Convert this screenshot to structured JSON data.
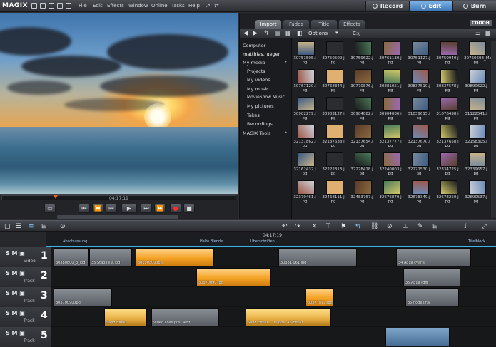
{
  "app": {
    "title": "MAGIX"
  },
  "menu": [
    "File",
    "Edit",
    "Effects",
    "Window",
    "Online",
    "Tasks",
    "Help"
  ],
  "modes": [
    {
      "label": "Record",
      "active": false
    },
    {
      "label": "Edit",
      "active": true
    },
    {
      "label": "Burn",
      "active": false
    }
  ],
  "preview": {
    "timecode": "04:17:19"
  },
  "browser": {
    "tabs": [
      "Import",
      "Fades",
      "Title",
      "Effects"
    ],
    "active_tab": "Import",
    "brand": "COOOH",
    "options_label": "Options",
    "path": "C:\\",
    "tree": [
      "Computer",
      "matthias.rueger",
      "My media",
      "Projects",
      "My videos",
      "My music",
      "MovieShow Music",
      "My pictures",
      "Takes",
      "Recordings",
      "MAGIX Tools"
    ],
    "files": [
      "30751505.jpg",
      "30750509.jpg",
      "30759622.jpg",
      "30761130.jpg",
      "30751127.jpg",
      "30750940.jpg",
      "30760698_Matty.jpg",
      "30767120.jpg",
      "30768344.jpg",
      "30770876.jpg",
      "30881051.jpg",
      "30837510.jpg",
      "30837578.jpg",
      "30890622.jpg",
      "30902279.jpg",
      "30903127.jpg",
      "30904082.jpg",
      "30904080.jpg",
      "31039615.jpg",
      "31076498.jpg",
      "31122541.jpg",
      "32137862.jpg",
      "32137638.jpg",
      "32137654.jpg",
      "32137777.jpg",
      "32137670.jpg",
      "32137658.jpg",
      "32158305.jpg",
      "32162432.jpg",
      "32222313.jpg",
      "32228418.jpg",
      "32240003.jpg",
      "32271530.jpg",
      "32334725.jpg",
      "32339657.jpg",
      "32379461.jpg",
      "32468111.jpg",
      "32483767.jpg",
      "32676870.jpg",
      "32678349.jpg",
      "32678250.jpg",
      "32690537.jpg"
    ]
  },
  "timeline": {
    "timecode": "04:17:19",
    "markers": [
      "Abschlussung",
      "Halte Blende",
      "Überschriften",
      "Titelblock"
    ],
    "tracks": [
      {
        "num": "1",
        "name": "Video"
      },
      {
        "num": "2",
        "name": "Track"
      },
      {
        "num": "3",
        "name": "Track"
      },
      {
        "num": "4",
        "name": "Track"
      },
      {
        "num": "5",
        "name": "Track"
      }
    ],
    "clips": [
      {
        "track": 0,
        "label": "30380800_3_jpg",
        "type": "gray"
      },
      {
        "track": 0,
        "label": "35 Stabil lila.jpg",
        "type": "gray"
      },
      {
        "track": 0,
        "label": "30190300.jpg",
        "type": "orange"
      },
      {
        "track": 0,
        "label": "30381 061.jpg",
        "type": "gray"
      },
      {
        "track": 0,
        "label": "34 Aqua cyans",
        "type": "gray"
      },
      {
        "track": 1,
        "label": "30370090.jpg",
        "type": "orange"
      },
      {
        "track": 1,
        "label": "35 Aqua rgm",
        "type": "gray"
      },
      {
        "track": 2,
        "label": "30370090.jpg",
        "type": "gray"
      },
      {
        "track": 2,
        "label": "30377811.jpg",
        "type": "orange"
      },
      {
        "track": 2,
        "label": "35 hoge lina",
        "type": "gray"
      },
      {
        "track": 3,
        "label": "Sand Effekt",
        "type": "wave"
      },
      {
        "track": 3,
        "label": "Video lines pos. Artif",
        "type": "gray"
      },
      {
        "track": 3,
        "label": "Sand Effekt … rs pos. A5 Effekt",
        "type": "wave"
      },
      {
        "track": 4,
        "label": "",
        "type": "blue"
      }
    ]
  }
}
